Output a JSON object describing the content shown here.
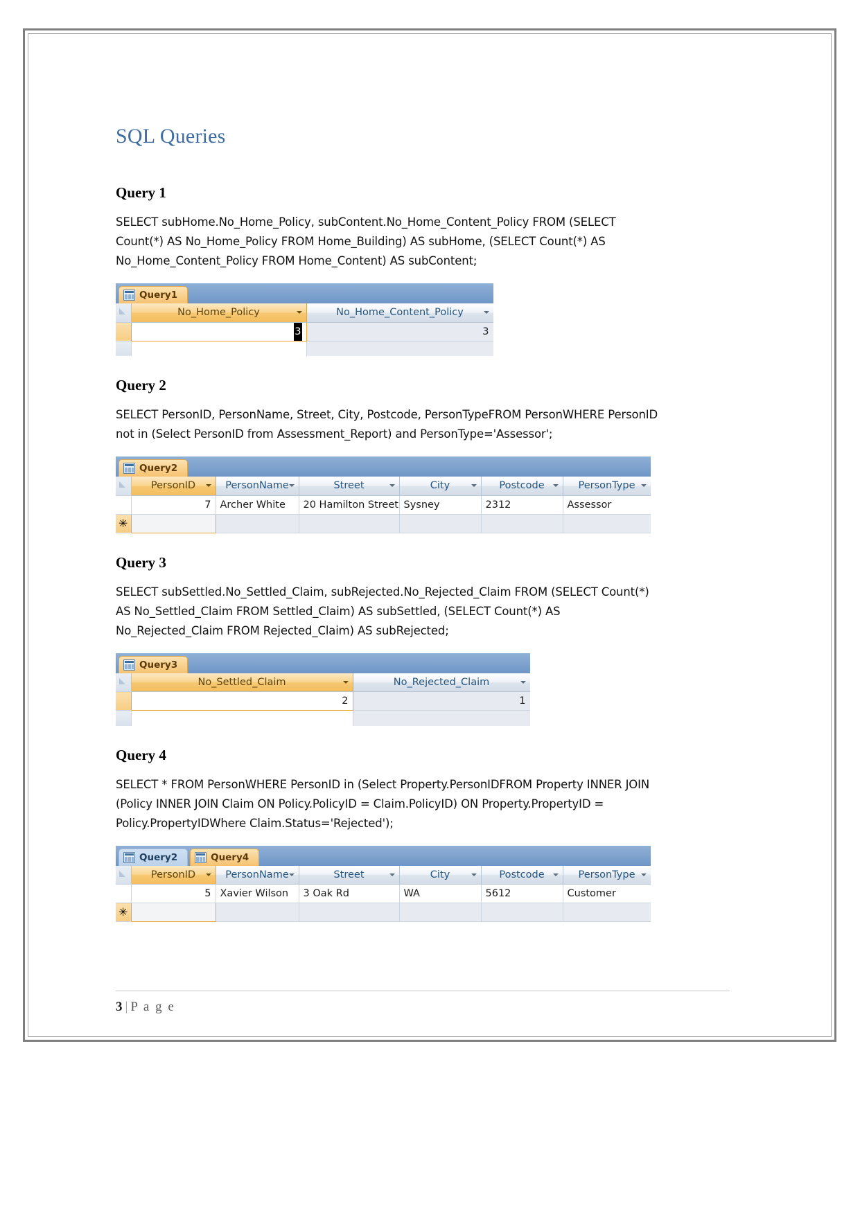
{
  "document": {
    "title": "SQL Queries",
    "footer": {
      "page_number": "3",
      "separator": "|",
      "page_word": "P a g e"
    }
  },
  "queries": [
    {
      "heading": "Query 1",
      "sql": "SELECT subHome.No_Home_Policy, subContent.No_Home_Content_Policy FROM (SELECT Count(*) AS No_Home_Policy FROM Home_Building)  AS subHome, (SELECT Count(*) AS No_Home_Content_Policy FROM Home_Content)  AS subContent;",
      "datasheet": {
        "tabs": [
          {
            "label": "Query1",
            "active": true
          }
        ],
        "columns": [
          "No_Home_Policy",
          "No_Home_Content_Policy"
        ],
        "rows": [
          [
            "3",
            "3"
          ]
        ]
      }
    },
    {
      "heading": "Query 2",
      "sql": "SELECT PersonID, PersonName, Street, City, Postcode, PersonTypeFROM PersonWHERE PersonID not in (Select PersonID from Assessment_Report) and PersonType='Assessor';",
      "datasheet": {
        "tabs": [
          {
            "label": "Query2",
            "active": true
          }
        ],
        "columns": [
          "PersonID",
          "PersonName",
          "Street",
          "City",
          "Postcode",
          "PersonType"
        ],
        "rows": [
          [
            "7",
            "Archer White",
            "20 Hamilton Street",
            "Sysney",
            "2312",
            "Assessor"
          ]
        ],
        "new_row_marker": "✳"
      }
    },
    {
      "heading": "Query 3",
      "sql": "SELECT subSettled.No_Settled_Claim, subRejected.No_Rejected_Claim FROM (SELECT Count(*) AS No_Settled_Claim FROM Settled_Claim)  AS subSettled, (SELECT Count(*) AS No_Rejected_Claim FROM Rejected_Claim)  AS subRejected;",
      "datasheet": {
        "tabs": [
          {
            "label": "Query3",
            "active": true
          }
        ],
        "columns": [
          "No_Settled_Claim",
          "No_Rejected_Claim"
        ],
        "rows": [
          [
            "2",
            "1"
          ]
        ]
      }
    },
    {
      "heading": "Query 4",
      "sql": "SELECT * FROM PersonWHERE PersonID in (Select Property.PersonIDFROM Property INNER JOIN (Policy INNER JOIN Claim ON Policy.PolicyID = Claim.PolicyID) ON Property.PropertyID = Policy.PropertyIDWhere Claim.Status='Rejected');",
      "datasheet": {
        "tabs": [
          {
            "label": "Query2",
            "active": false
          },
          {
            "label": "Query4",
            "active": true
          }
        ],
        "columns": [
          "PersonID",
          "PersonName",
          "Street",
          "City",
          "Postcode",
          "PersonType"
        ],
        "rows": [
          [
            "5",
            "Xavier Wilson",
            "3 Oak Rd",
            "WA",
            "5612",
            "Customer"
          ]
        ],
        "new_row_marker": "✳"
      }
    }
  ],
  "colors": {
    "title": "#3d6ca3",
    "tab_active": "#f6c271",
    "tab_strip": "#7fa3ce",
    "header_selected": "#f4bd5c"
  }
}
